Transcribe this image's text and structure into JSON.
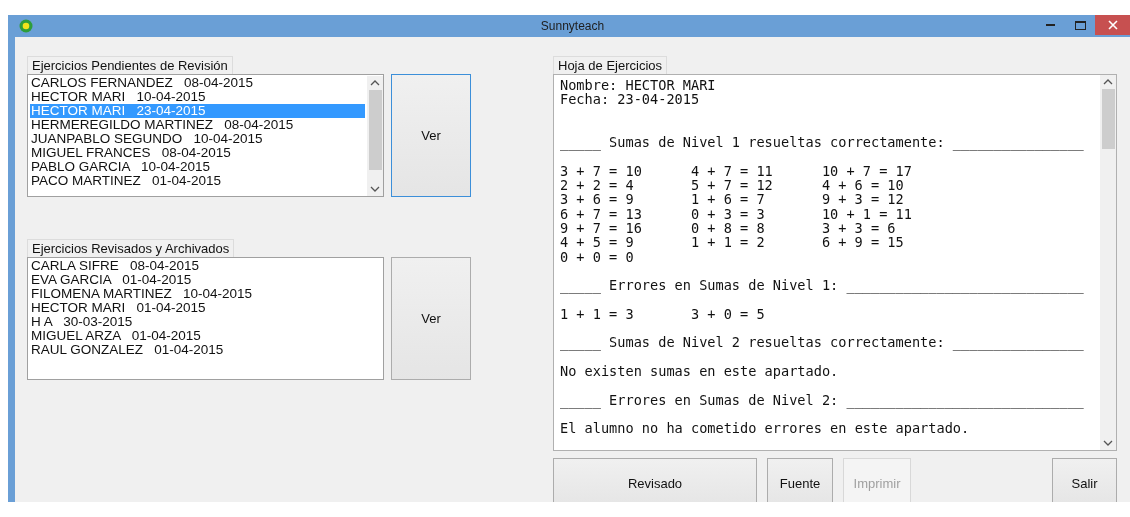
{
  "window": {
    "title": "Sunnyteach"
  },
  "pending": {
    "label": "Ejercicios Pendientes de Revisión",
    "button": {
      "label": "Ver",
      "focused": true
    },
    "items": [
      {
        "text": "CARLOS FERNANDEZ   08-04-2015",
        "selected": false
      },
      {
        "text": "HECTOR MARI   10-04-2015",
        "selected": false
      },
      {
        "text": "HECTOR MARI   23-04-2015",
        "selected": true
      },
      {
        "text": "HERMEREGILDO MARTINEZ   08-04-2015",
        "selected": false
      },
      {
        "text": "JUANPABLO SEGUNDO   10-04-2015",
        "selected": false
      },
      {
        "text": "MIGUEL FRANCES   08-04-2015",
        "selected": false
      },
      {
        "text": "PABLO GARCIA   10-04-2015",
        "selected": false
      },
      {
        "text": "PACO MARTINEZ   01-04-2015",
        "selected": false
      }
    ]
  },
  "archived": {
    "label": "Ejercicios Revisados y Archivados",
    "button": {
      "label": "Ver",
      "focused": false
    },
    "items": [
      {
        "text": "CARLA SIFRE   08-04-2015",
        "selected": false
      },
      {
        "text": "EVA GARCIA   01-04-2015",
        "selected": false
      },
      {
        "text": "FILOMENA MARTINEZ   10-04-2015",
        "selected": false
      },
      {
        "text": "HECTOR MARI   01-04-2015",
        "selected": false
      },
      {
        "text": "H A   30-03-2015",
        "selected": false
      },
      {
        "text": "MIGUEL ARZA   01-04-2015",
        "selected": false
      },
      {
        "text": "RAUL GONZALEZ   01-04-2015",
        "selected": false
      }
    ]
  },
  "sheet": {
    "label": "Hoja de Ejercicios",
    "header": [
      "Nombre: HECTOR MARI",
      "Fecha: 23-04-2015"
    ],
    "sections": [
      {
        "heading": "_____ Sumas de Nivel 1 resueltas correctamente: ________________",
        "rows": [
          [
            "3 + 7 = 10",
            "4 + 7 = 11",
            "10 + 7 = 17"
          ],
          [
            "2 + 2 = 4",
            "5 + 7 = 12",
            "4 + 6 = 10"
          ],
          [
            "3 + 6 = 9",
            "1 + 6 = 7",
            "9 + 3 = 12"
          ],
          [
            "6 + 7 = 13",
            "0 + 3 = 3",
            "10 + 1 = 11"
          ],
          [
            "9 + 7 = 16",
            "0 + 8 = 8",
            "3 + 3 = 6"
          ],
          [
            "4 + 5 = 9",
            "1 + 1 = 2",
            "6 + 9 = 15"
          ],
          [
            "0 + 0 = 0"
          ]
        ]
      },
      {
        "heading": "_____ Errores en Sumas de Nivel 1: _____________________________",
        "rows": [
          [
            "1 + 1 = 3",
            "3 + 0 = 5"
          ]
        ]
      },
      {
        "heading": "_____ Sumas de Nivel 2 resueltas correctamente: ________________",
        "rows": [
          [
            "No existen sumas en este apartado."
          ]
        ]
      },
      {
        "heading": "_____ Errores en Sumas de Nivel 2: _____________________________",
        "rows": [
          [
            "El alumno no ha cometido errores en este apartado."
          ]
        ]
      }
    ]
  },
  "buttons": [
    {
      "label": "Revisado",
      "disabled": false
    },
    {
      "label": "Fuente",
      "disabled": false
    },
    {
      "label": "Imprimir",
      "disabled": true
    },
    {
      "label": "Salir",
      "disabled": false
    }
  ]
}
